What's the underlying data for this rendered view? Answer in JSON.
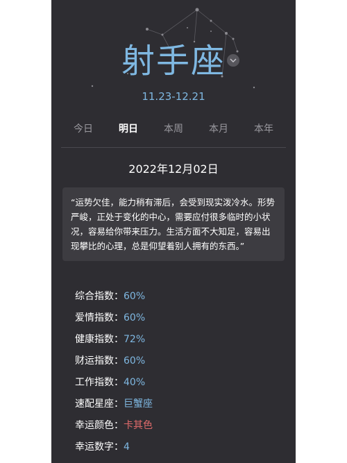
{
  "sign": {
    "name": "射手座",
    "date_range": "11.23-12.21",
    "dropdown_icon": "chevron-down-icon"
  },
  "tabs": [
    {
      "label": "今日",
      "active": false
    },
    {
      "label": "明日",
      "active": true
    },
    {
      "label": "本周",
      "active": false
    },
    {
      "label": "本月",
      "active": false
    },
    {
      "label": "本年",
      "active": false
    }
  ],
  "forecast": {
    "date": "2022年12月02日",
    "summary": "“运势欠佳，能力稍有滞后，会受到现实泼冷水。形势严峻，正处于变化的中心，需要应付很多临时的小状况，容易给你带来压力。生活方面不大知足，容易出现攀比的心理，总是仰望着别人拥有的东西。”"
  },
  "stats": [
    {
      "label": "综合指数：",
      "value": "60%"
    },
    {
      "label": "爱情指数：",
      "value": "60%"
    },
    {
      "label": "健康指数：",
      "value": "72%"
    },
    {
      "label": "财运指数：",
      "value": "60%"
    },
    {
      "label": "工作指数：",
      "value": "40%"
    },
    {
      "label": "速配星座：",
      "value": "巨蟹座"
    },
    {
      "label": "幸运颜色：",
      "value": "卡其色",
      "color": "#e06b6b"
    },
    {
      "label": "幸运数字：",
      "value": "4"
    }
  ],
  "colors": {
    "background": "#2e2d32",
    "accent": "#7fb8e2",
    "lucky_color": "#e06b6b"
  }
}
